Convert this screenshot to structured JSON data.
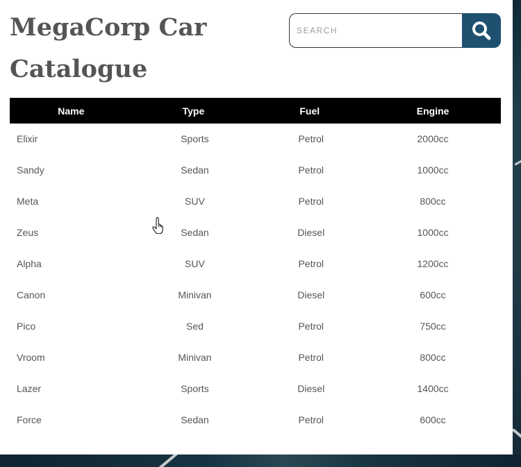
{
  "page": {
    "title": "MegaCorp Car Catalogue"
  },
  "search": {
    "placeholder": "SEARCH",
    "value": "",
    "icon": "search-icon",
    "button_color": "#1f5070"
  },
  "table": {
    "columns": [
      "Name",
      "Type",
      "Fuel",
      "Engine"
    ],
    "header_bg": "#000000",
    "rows": [
      [
        "Elixir",
        "Sports",
        "Petrol",
        "2000cc"
      ],
      [
        "Sandy",
        "Sedan",
        "Petrol",
        "1000cc"
      ],
      [
        "Meta",
        "SUV",
        "Petrol",
        "800cc"
      ],
      [
        "Zeus",
        "Sedan",
        "Diesel",
        "1000cc"
      ],
      [
        "Alpha",
        "SUV",
        "Petrol",
        "1200cc"
      ],
      [
        "Canon",
        "Minivan",
        "Diesel",
        "600cc"
      ],
      [
        "Pico",
        "Sed",
        "Petrol",
        "750cc"
      ],
      [
        "Vroom",
        "Minivan",
        "Petrol",
        "800cc"
      ],
      [
        "Lazer",
        "Sports",
        "Diesel",
        "1400cc"
      ],
      [
        "Force",
        "Sedan",
        "Petrol",
        "600cc"
      ]
    ]
  },
  "cursor": {
    "icon": "hand-pointer-icon"
  }
}
